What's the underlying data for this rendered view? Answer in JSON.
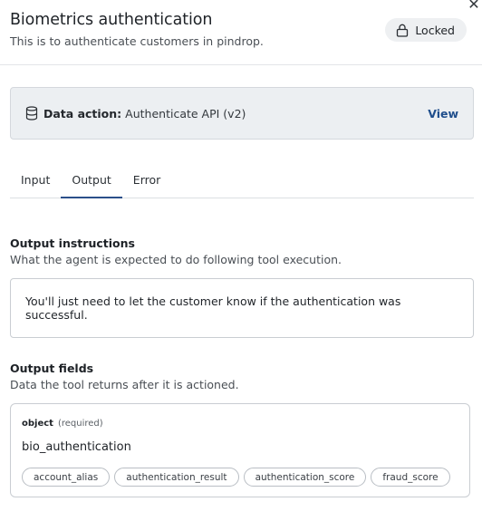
{
  "header": {
    "title": "Biometrics authentication",
    "subtitle": "This is to authenticate customers in pindrop.",
    "lock_badge": "Locked",
    "close_glyph": "✕"
  },
  "data_action": {
    "icon": "database-icon",
    "label": "Data action:",
    "value": "Authenticate API (v2)",
    "view_label": "View"
  },
  "tabs": [
    {
      "label": "Input",
      "active": false
    },
    {
      "label": "Output",
      "active": true
    },
    {
      "label": "Error",
      "active": false
    }
  ],
  "output_instructions": {
    "title": "Output instructions",
    "subtitle": "What the agent is expected to do following tool execution.",
    "text": "You'll just need to let the customer know if the authentication was successful."
  },
  "output_fields": {
    "title": "Output fields",
    "subtitle": "Data the tool returns after it is actioned.",
    "object_type": "object",
    "object_required": "(required)",
    "object_name": "bio_authentication",
    "chips": [
      "account_alias",
      "authentication_result",
      "authentication_score",
      "fraud_score"
    ]
  },
  "colors": {
    "accent": "#2b4f8a",
    "link": "#1f4e8c",
    "badge_bg": "#eef0f2",
    "panel_bg": "#eceff2"
  }
}
